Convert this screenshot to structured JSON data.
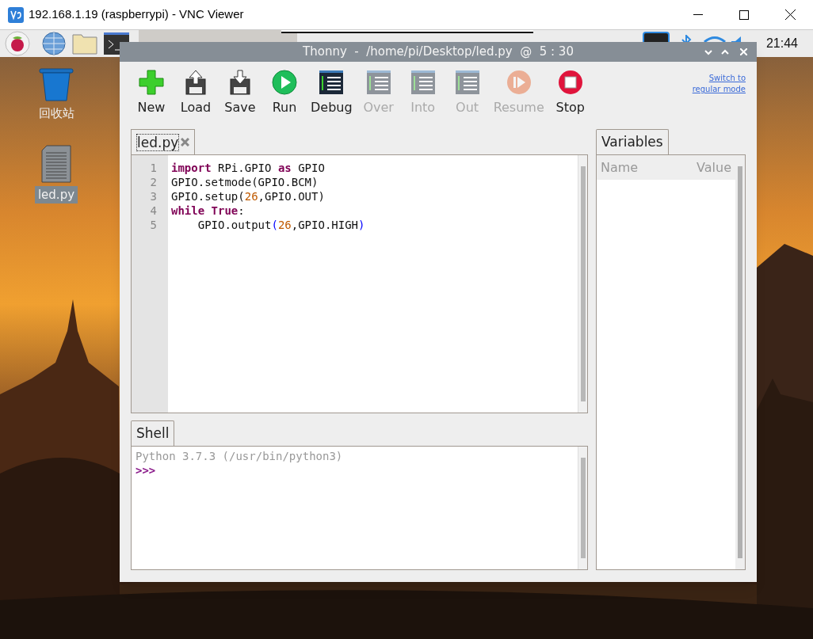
{
  "vnc_window": {
    "title": "192.168.1.19 (raspberrypi) - VNC Viewer"
  },
  "taskbar": {
    "clock": "21:44"
  },
  "desktop_icons": [
    {
      "kind": "trash",
      "label": "回收站",
      "selected": false
    },
    {
      "kind": "file",
      "label": "led.py",
      "selected": true
    }
  ],
  "thonny": {
    "title": "Thonny  -  /home/pi/Desktop/led.py  @  5 : 30",
    "toolbar": [
      {
        "kind": "new",
        "label": "New",
        "disabled": false
      },
      {
        "kind": "load",
        "label": "Load",
        "disabled": false
      },
      {
        "kind": "save",
        "label": "Save",
        "disabled": false
      },
      {
        "kind": "run",
        "label": "Run",
        "disabled": false
      },
      {
        "kind": "debug",
        "label": "Debug",
        "disabled": false
      },
      {
        "kind": "over",
        "label": "Over",
        "disabled": true
      },
      {
        "kind": "into",
        "label": "Into",
        "disabled": true
      },
      {
        "kind": "out",
        "label": "Out",
        "disabled": true
      },
      {
        "kind": "resume",
        "label": "Resume",
        "disabled": true
      },
      {
        "kind": "stop",
        "label": "Stop",
        "disabled": false
      }
    ],
    "mode_link": "Switch to regular mode",
    "editor": {
      "tab": {
        "label": "led.py",
        "selected": true
      },
      "lines": [
        {
          "number": "1",
          "tokens": [
            {
              "kind": "keyword",
              "text": "import"
            },
            {
              "kind": "plain",
              "text": " RPi.GPIO "
            },
            {
              "kind": "keyword",
              "text": "as"
            },
            {
              "kind": "plain",
              "text": " GPIO"
            }
          ]
        },
        {
          "number": "2",
          "tokens": [
            {
              "kind": "plain",
              "text": "GPIO.setmode(GPIO.BCM)"
            }
          ]
        },
        {
          "number": "3",
          "tokens": [
            {
              "kind": "plain",
              "text": "GPIO.setup("
            },
            {
              "kind": "number",
              "text": "26"
            },
            {
              "kind": "plain",
              "text": ",GPIO.OUT)"
            }
          ]
        },
        {
          "number": "4",
          "tokens": [
            {
              "kind": "keyword",
              "text": "while True"
            },
            {
              "kind": "plain",
              "text": ":"
            }
          ]
        },
        {
          "number": "5",
          "tokens": [
            {
              "kind": "plain",
              "text": "    GPIO.output"
            },
            {
              "kind": "paren",
              "text": "("
            },
            {
              "kind": "number",
              "text": "26"
            },
            {
              "kind": "plain",
              "text": ",GPIO.HIGH"
            },
            {
              "kind": "paren",
              "text": ")"
            }
          ]
        }
      ]
    },
    "shell": {
      "tab": {
        "label": "Shell",
        "selected": true
      },
      "banner": "Python 3.7.3 (/usr/bin/python3)",
      "prompt": ">>>"
    },
    "variables": {
      "tab": {
        "label": "Variables",
        "selected": true
      },
      "columns": [
        "Name",
        "Value"
      ]
    }
  }
}
